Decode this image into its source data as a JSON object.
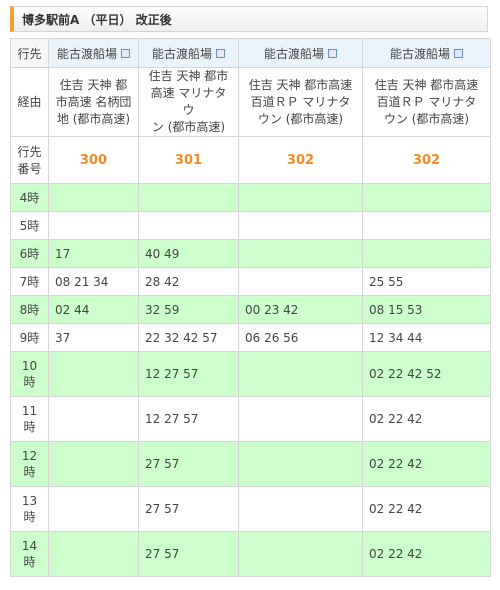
{
  "title": "博多駅前A （平日） 改正後",
  "header": {
    "row_label": "行先",
    "destinations": [
      "能古渡船場",
      "能古渡船場",
      "能古渡船場",
      "能古渡船場"
    ]
  },
  "via": {
    "row_label": "経由",
    "routes": [
      [
        "住吉 天神 都",
        "市高速 名柄団",
        "地 (都市高速)"
      ],
      [
        "住吉 天神 都市",
        "高速 マリナタウ",
        "ン (都市高速)"
      ],
      [
        "住吉 天神 都市高速",
        "百道ＲＰ マリナタ",
        "ウン (都市高速)"
      ],
      [
        "住吉 天神 都市高速",
        "百道ＲＰ マリナタ",
        "ウン (都市高速)"
      ]
    ]
  },
  "route_number": {
    "row_label": [
      "行先",
      "番号"
    ],
    "values": [
      "300",
      "301",
      "302",
      "302"
    ]
  },
  "hours": [
    {
      "label": [
        "4時"
      ],
      "cells": [
        "",
        "",
        "",
        ""
      ],
      "green": true
    },
    {
      "label": [
        "5時"
      ],
      "cells": [
        "",
        "",
        "",
        ""
      ],
      "green": false
    },
    {
      "label": [
        "6時"
      ],
      "cells": [
        "17",
        "40 49",
        "",
        ""
      ],
      "green": true
    },
    {
      "label": [
        "7時"
      ],
      "cells": [
        "08 21 34",
        "28 42",
        "",
        "25 55"
      ],
      "green": false
    },
    {
      "label": [
        "8時"
      ],
      "cells": [
        "02 44",
        "32 59",
        "00 23 42",
        "08 15 53"
      ],
      "green": true
    },
    {
      "label": [
        "9時"
      ],
      "cells": [
        "37",
        "22 32 42 57",
        "06 26 56",
        "12 34 44"
      ],
      "green": false
    },
    {
      "label": [
        "10",
        "時"
      ],
      "cells": [
        "",
        "12 27 57",
        "",
        "02 22 42 52"
      ],
      "green": true
    },
    {
      "label": [
        "11",
        "時"
      ],
      "cells": [
        "",
        "12 27 57",
        "",
        "02 22 42"
      ],
      "green": false
    },
    {
      "label": [
        "12",
        "時"
      ],
      "cells": [
        "",
        "27 57",
        "",
        "02 22 42"
      ],
      "green": true
    },
    {
      "label": [
        "13",
        "時"
      ],
      "cells": [
        "",
        "27 57",
        "",
        "02 22 42"
      ],
      "green": false
    },
    {
      "label": [
        "14",
        "時"
      ],
      "cells": [
        "",
        "27 57",
        "",
        "02 22 42"
      ],
      "green": true
    }
  ],
  "icons": {
    "destination_link": "external-link-icon"
  },
  "colors": {
    "green_row": "#ccffcc",
    "route_number": "#f08a24",
    "header_bg": "#eaf2fa",
    "accent": "#f0a030"
  }
}
